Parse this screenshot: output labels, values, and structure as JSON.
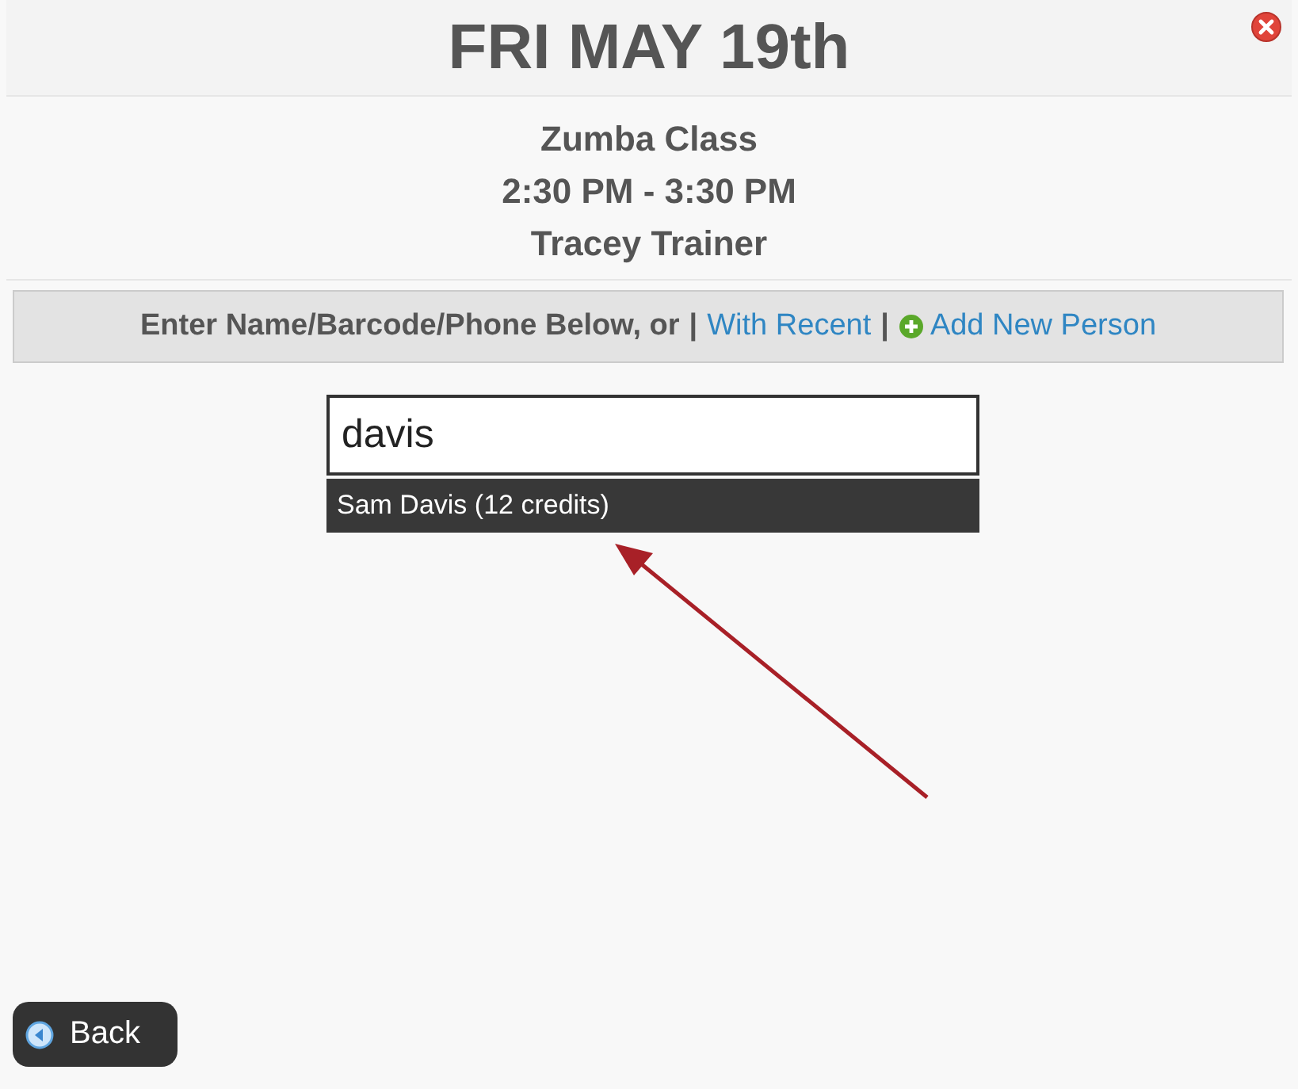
{
  "header": {
    "title": "FRI MAY 19th"
  },
  "event": {
    "lines": [
      "Zumba Class",
      "2:30 PM - 3:30 PM",
      "Tracey Trainer"
    ]
  },
  "instructions": {
    "text": "Enter Name/Barcode/Phone Below, or",
    "separator": "|",
    "recent_link": "With Recent",
    "add_link": "Add New Person"
  },
  "search": {
    "value": "davis"
  },
  "suggestions": [
    {
      "label": "Sam Davis (12 credits)",
      "selected": true
    }
  ],
  "back_button": {
    "label": "Back"
  }
}
